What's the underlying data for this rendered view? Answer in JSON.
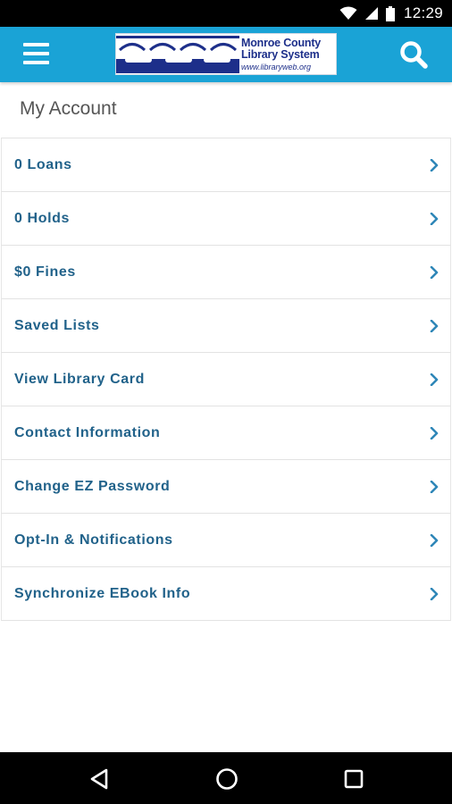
{
  "status_bar": {
    "time": "12:29",
    "icons": [
      "wifi-icon",
      "cell-signal-icon",
      "battery-icon"
    ]
  },
  "app_bar": {
    "menu_icon": "hamburger-menu-icon",
    "search_icon": "search-icon",
    "logo": {
      "line1": "Monroe County",
      "line2": "Library System",
      "url": "www.libraryweb.org"
    },
    "color": "#1aa3d6"
  },
  "page": {
    "title": "My Account"
  },
  "menu": {
    "items": [
      {
        "label": "0 Loans"
      },
      {
        "label": "0 Holds"
      },
      {
        "label": "$0 Fines"
      },
      {
        "label": "Saved Lists"
      },
      {
        "label": "View Library Card"
      },
      {
        "label": "Contact Information"
      },
      {
        "label": "Change EZ Password"
      },
      {
        "label": "Opt-In & Notifications"
      },
      {
        "label": "Synchronize EBook Info"
      }
    ],
    "item_color": "#21628a",
    "chevron_color": "#2f87b8"
  },
  "nav_bar": {
    "icons": [
      "back-triangle-icon",
      "home-circle-icon",
      "recents-square-icon"
    ]
  }
}
